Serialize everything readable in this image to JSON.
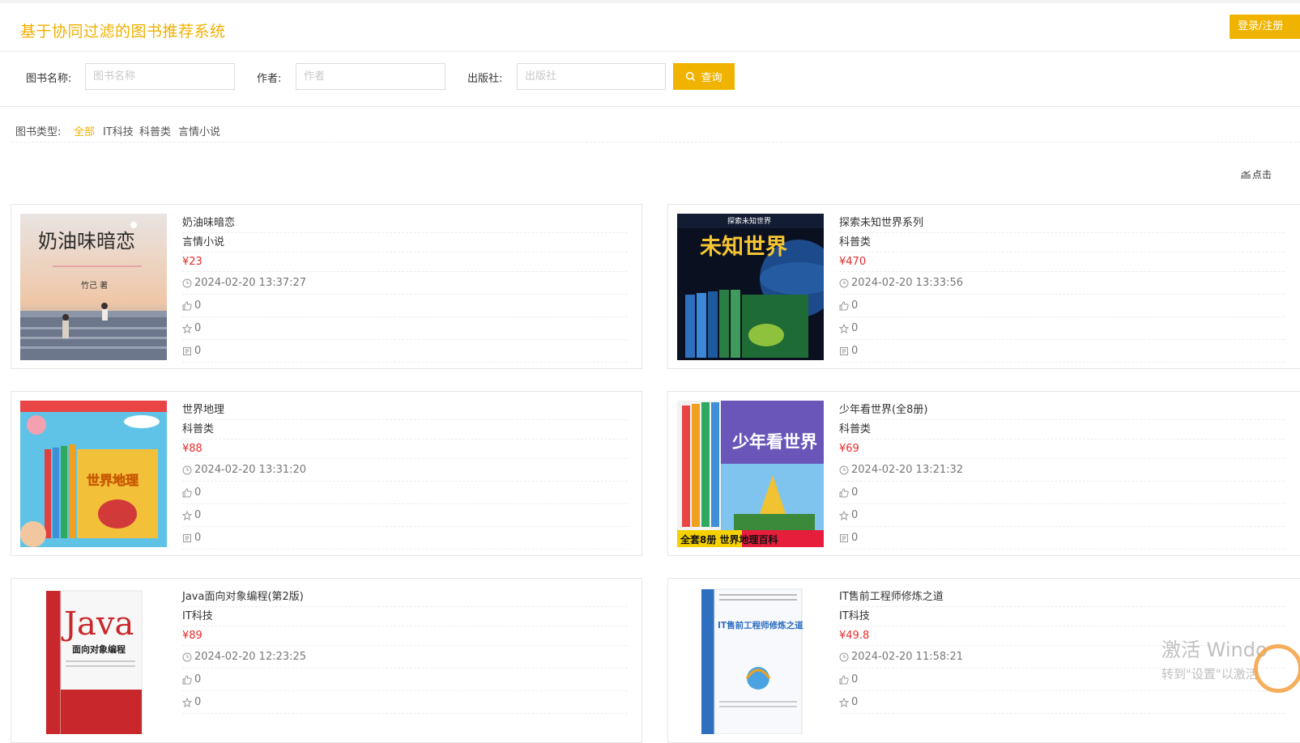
{
  "header": {
    "title": "基于协同过滤的图书推荐系统",
    "login_label": "登录/注册"
  },
  "search": {
    "name_label": "图书名称:",
    "name_placeholder": "图书名称",
    "author_label": "作者:",
    "author_placeholder": "作者",
    "publisher_label": "出版社:",
    "publisher_placeholder": "出版社",
    "query_label": "查询"
  },
  "types": {
    "label": "图书类型:",
    "items": [
      "全部",
      "IT科技",
      "科普类",
      "言情小说"
    ],
    "active_index": 0
  },
  "hot_link": "点击",
  "colors": {
    "accent": "#f0b400",
    "price": "#e62b2b"
  },
  "books": [
    {
      "title": "奶油味暗恋",
      "category": "言情小说",
      "price": "¥23",
      "time": "2024-02-20 13:37:27",
      "likes": "0",
      "favorites": "0",
      "comments": "0",
      "cover_text": "奶油味暗恋",
      "cover_author": "竹己 著"
    },
    {
      "title": "探索未知世界系列",
      "category": "科普类",
      "price": "¥470",
      "time": "2024-02-20 13:33:56",
      "likes": "0",
      "favorites": "0",
      "comments": "0",
      "cover_text": "未知世界",
      "cover_sub": "探索未知世界"
    },
    {
      "title": "世界地理",
      "category": "科普类",
      "price": "¥88",
      "time": "2024-02-20 13:31:20",
      "likes": "0",
      "favorites": "0",
      "comments": "0",
      "cover_text": "世界地理"
    },
    {
      "title": "少年看世界(全8册)",
      "category": "科普类",
      "price": "¥69",
      "time": "2024-02-20 13:21:32",
      "likes": "0",
      "favorites": "0",
      "comments": "0",
      "cover_text": "少年看世界",
      "cover_sub": "全套8册 世界地理百科"
    },
    {
      "title": "Java面向对象编程(第2版)",
      "category": "IT科技",
      "price": "¥89",
      "time": "2024-02-20 12:23:25",
      "likes": "0",
      "favorites": "0",
      "comments": "",
      "cover_text": "Java",
      "cover_sub": "面向对象编程"
    },
    {
      "title": "IT售前工程师修炼之道",
      "category": "IT科技",
      "price": "¥49.8",
      "time": "2024-02-20 11:58:21",
      "likes": "0",
      "favorites": "0",
      "comments": "",
      "cover_text": "IT售前工程师修炼之道"
    }
  ],
  "watermark": {
    "line1": "激活 Windo",
    "line2": "转到\"设置\"以激活"
  }
}
